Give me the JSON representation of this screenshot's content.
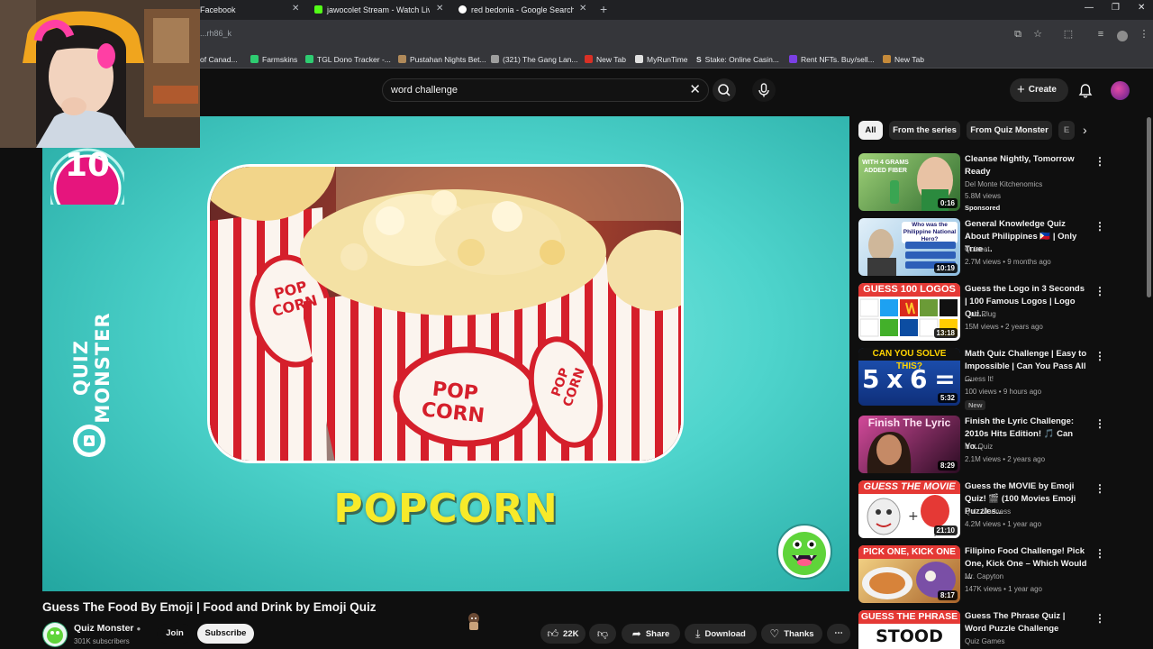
{
  "browser": {
    "tabs": [
      {
        "label": "Facebook",
        "fav_color": "#1877f2"
      },
      {
        "label": "jawocolet Stream - Watch Live",
        "fav_color": "#53fc18"
      },
      {
        "label": "red bedonia - Google Search",
        "fav_color": "#ffffff"
      }
    ],
    "url": "...rh86_k",
    "bookmarks": [
      {
        "label": "of Canad...",
        "fav_color": "#888888"
      },
      {
        "label": "Farmskins",
        "fav_color": "#2ecc71"
      },
      {
        "label": "TGL Dono Tracker -...",
        "fav_color": "#2ecc71"
      },
      {
        "label": "Pustahan Nights Bet...",
        "fav_color": "#b08a5a"
      },
      {
        "label": "(321) The Gang Lan...",
        "fav_color": "#9e9e9e"
      },
      {
        "label": "New Tab",
        "fav_color": "#d93025"
      },
      {
        "label": "MyRunTime",
        "fav_color": "#e0e0e0"
      },
      {
        "label": "Stake: Online Casin...",
        "fav_color": "#1a2c38"
      },
      {
        "label": "Rent NFTs. Buy/sell...",
        "fav_color": "#7b3fe4"
      },
      {
        "label": "New Tab",
        "fav_color": "#c58a3a"
      }
    ]
  },
  "youtube": {
    "search_query": "word challenge",
    "create_label": "Create"
  },
  "video": {
    "badge_number": "10",
    "brand_text": "QUIZ MONSTER",
    "answer": "POPCORN",
    "box_text_front": "POP CORN",
    "box_text_left": "POP CORN",
    "box_text_right": "POP CORN",
    "title": "Guess The Food By Emoji | Food and Drink by Emoji Quiz",
    "channel": "Quiz Monster",
    "subscribers": "301K subscribers",
    "join_label": "Join",
    "subscribe_label": "Subscribe",
    "likes": "22K",
    "share_label": "Share",
    "download_label": "Download",
    "thanks_label": "Thanks"
  },
  "chips": [
    "All",
    "From the series",
    "From Quiz Monster",
    "E"
  ],
  "recommendations": [
    {
      "title": "Cleanse Nightly, Tomorrow Ready",
      "channel": "Del Monte Kitchenomics",
      "meta": "5.8M views",
      "badge": "Sponsored",
      "duration": "0:16",
      "overlay": "WITH 4 GRAMS ADDED FIBER",
      "colors": [
        "#8ec36b",
        "#2f6b2e"
      ]
    },
    {
      "title": "General Knowledge Quiz About Philippines 🇵🇭 | Only True ...",
      "channel": "Quizeat",
      "meta": "2.7M views • 9 months ago",
      "badge": "",
      "duration": "10:19",
      "overlay": "Who was the Philippine National Hero?",
      "colors": [
        "#cfe6f5",
        "#7fb2d8"
      ]
    },
    {
      "title": "Guess the Logo in 3 Seconds | 100 Famous Logos | Logo Qui...",
      "channel": "Quiz Plug",
      "meta": "15M views • 2 years ago",
      "badge": "",
      "duration": "13:18",
      "overlay": "GUESS 100 LOGOS",
      "colors": [
        "#ffffff",
        "#e5e5e5"
      ]
    },
    {
      "title": "Math Quiz Challenge | Easy to Impossible | Can You Pass All ...",
      "channel": "Guess It!",
      "meta": "100 views • 9 hours ago",
      "badge": "New",
      "duration": "5:32",
      "overlay": "CAN YOU SOLVE THIS?",
      "math": "5 x 6 = ?",
      "colors": [
        "#2b6fd6",
        "#1b3f8f"
      ]
    },
    {
      "title": "Finish the Lyric Challenge: 2010s Hits Edition! 🎵 Can Yo...",
      "channel": "Hot Quiz",
      "meta": "2.1M views • 2 years ago",
      "badge": "",
      "duration": "8:29",
      "overlay": "Finish The Lyric",
      "colors": [
        "#c43b8e",
        "#3b1030"
      ]
    },
    {
      "title": "Guess the MOVIE by Emoji Quiz! 🎬 (100 Movies Emoji Puzzles...",
      "channel": "Quiz Madness",
      "meta": "4.2M views • 1 year ago",
      "badge": "",
      "duration": "21:10",
      "overlay": "GUESS THE MOVIE",
      "colors": [
        "#ffffff",
        "#f0f0f0"
      ]
    },
    {
      "title": "Filipino Food Challenge! Pick One, Kick One – Which Would ...",
      "channel": "Mr. Capyton",
      "meta": "147K views • 1 year ago",
      "badge": "",
      "duration": "8:17",
      "overlay": "PICK ONE, KICK ONE",
      "colors": [
        "#f7d27a",
        "#b36b2c"
      ]
    },
    {
      "title": "Guess The Phrase Quiz | Word Puzzle Challenge",
      "channel": "Quiz Games",
      "meta": "",
      "badge": "",
      "duration": "",
      "overlay": "GUESS THE PHRASE",
      "sub_overlay": "STOOD",
      "colors": [
        "#ffffff",
        "#eeeeee"
      ]
    }
  ]
}
